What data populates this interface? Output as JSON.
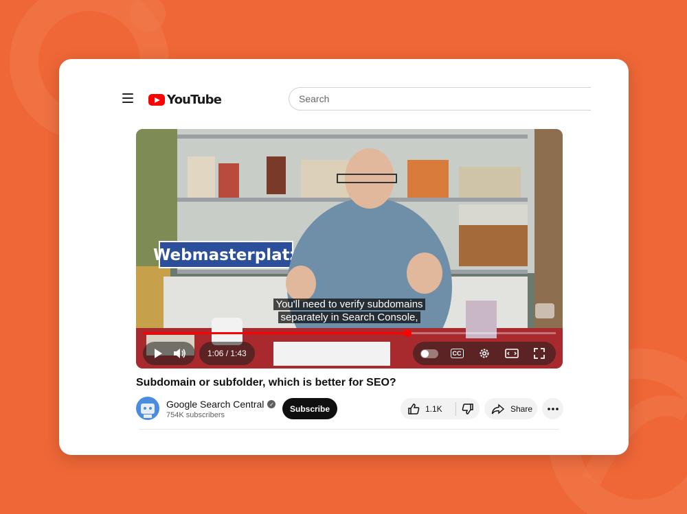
{
  "header": {
    "logo_text": "YouTube",
    "search_placeholder": "Search"
  },
  "player": {
    "captions": [
      "You'll need to verify subdomains",
      "separately in Search Console,"
    ],
    "sign_text": "Webmasterplatz",
    "time_display": "1:06 / 1:43",
    "progress_fraction": 0.64,
    "cc_label": "CC"
  },
  "video": {
    "title": "Subdomain or subfolder, which is better for SEO?",
    "channel_name": "Google Search Central",
    "subscribers": "754K subscribers",
    "subscribe_label": "Subscribe",
    "like_count": "1.1K",
    "share_label": "Share"
  },
  "colors": {
    "background": "#ef6737",
    "youtube_red": "#ff0000",
    "progress": "#ff0000"
  }
}
